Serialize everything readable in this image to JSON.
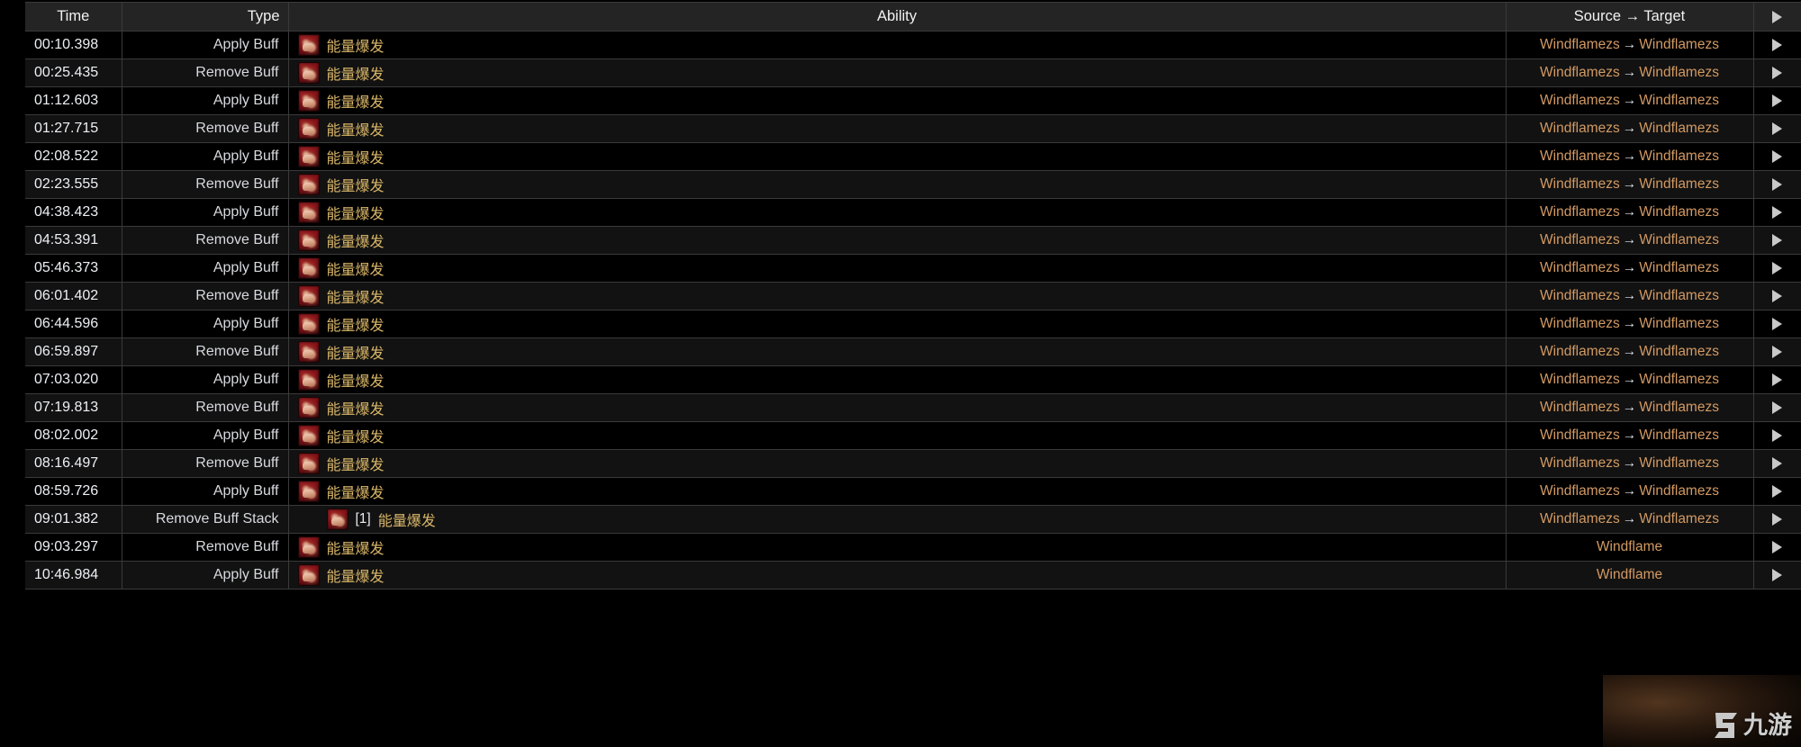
{
  "table": {
    "headers": {
      "time": "Time",
      "type": "Type",
      "ability": "Ability",
      "source_target": "Source → Target",
      "expand": ""
    },
    "arrow": "→",
    "colors": {
      "ability_name": "#d9b668",
      "source_link": "#d39a63",
      "row_odd_bg": "#000000",
      "row_even_bg": "#121212",
      "header_bg": "#242424",
      "grid_line": "#3a3a3a"
    },
    "rows": [
      {
        "time": "00:10.398",
        "type": "Apply Buff",
        "stack": "",
        "ability": "能量爆发",
        "source": "Windflamezs",
        "target": "Windflamezs",
        "indented": false
      },
      {
        "time": "00:25.435",
        "type": "Remove Buff",
        "stack": "",
        "ability": "能量爆发",
        "source": "Windflamezs",
        "target": "Windflamezs",
        "indented": false
      },
      {
        "time": "01:12.603",
        "type": "Apply Buff",
        "stack": "",
        "ability": "能量爆发",
        "source": "Windflamezs",
        "target": "Windflamezs",
        "indented": false
      },
      {
        "time": "01:27.715",
        "type": "Remove Buff",
        "stack": "",
        "ability": "能量爆发",
        "source": "Windflamezs",
        "target": "Windflamezs",
        "indented": false
      },
      {
        "time": "02:08.522",
        "type": "Apply Buff",
        "stack": "",
        "ability": "能量爆发",
        "source": "Windflamezs",
        "target": "Windflamezs",
        "indented": false
      },
      {
        "time": "02:23.555",
        "type": "Remove Buff",
        "stack": "",
        "ability": "能量爆发",
        "source": "Windflamezs",
        "target": "Windflamezs",
        "indented": false
      },
      {
        "time": "04:38.423",
        "type": "Apply Buff",
        "stack": "",
        "ability": "能量爆发",
        "source": "Windflamezs",
        "target": "Windflamezs",
        "indented": false
      },
      {
        "time": "04:53.391",
        "type": "Remove Buff",
        "stack": "",
        "ability": "能量爆发",
        "source": "Windflamezs",
        "target": "Windflamezs",
        "indented": false
      },
      {
        "time": "05:46.373",
        "type": "Apply Buff",
        "stack": "",
        "ability": "能量爆发",
        "source": "Windflamezs",
        "target": "Windflamezs",
        "indented": false
      },
      {
        "time": "06:01.402",
        "type": "Remove Buff",
        "stack": "",
        "ability": "能量爆发",
        "source": "Windflamezs",
        "target": "Windflamezs",
        "indented": false
      },
      {
        "time": "06:44.596",
        "type": "Apply Buff",
        "stack": "",
        "ability": "能量爆发",
        "source": "Windflamezs",
        "target": "Windflamezs",
        "indented": false
      },
      {
        "time": "06:59.897",
        "type": "Remove Buff",
        "stack": "",
        "ability": "能量爆发",
        "source": "Windflamezs",
        "target": "Windflamezs",
        "indented": false
      },
      {
        "time": "07:03.020",
        "type": "Apply Buff",
        "stack": "",
        "ability": "能量爆发",
        "source": "Windflamezs",
        "target": "Windflamezs",
        "indented": false
      },
      {
        "time": "07:19.813",
        "type": "Remove Buff",
        "stack": "",
        "ability": "能量爆发",
        "source": "Windflamezs",
        "target": "Windflamezs",
        "indented": false
      },
      {
        "time": "08:02.002",
        "type": "Apply Buff",
        "stack": "",
        "ability": "能量爆发",
        "source": "Windflamezs",
        "target": "Windflamezs",
        "indented": false
      },
      {
        "time": "08:16.497",
        "type": "Remove Buff",
        "stack": "",
        "ability": "能量爆发",
        "source": "Windflamezs",
        "target": "Windflamezs",
        "indented": false
      },
      {
        "time": "08:59.726",
        "type": "Apply Buff",
        "stack": "",
        "ability": "能量爆发",
        "source": "Windflamezs",
        "target": "Windflamezs",
        "indented": false
      },
      {
        "time": "09:01.382",
        "type": "Remove Buff Stack",
        "stack": "[1]",
        "ability": "能量爆发",
        "source": "Windflamezs",
        "target": "Windflamezs",
        "indented": true
      },
      {
        "time": "09:03.297",
        "type": "Remove Buff",
        "stack": "",
        "ability": "能量爆发",
        "source": "Windflame",
        "target": "",
        "indented": false
      },
      {
        "time": "10:46.984",
        "type": "Apply Buff",
        "stack": "",
        "ability": "能量爆发",
        "source": "Windflame",
        "target": "",
        "indented": false
      }
    ]
  },
  "watermark": {
    "text": "九游"
  }
}
